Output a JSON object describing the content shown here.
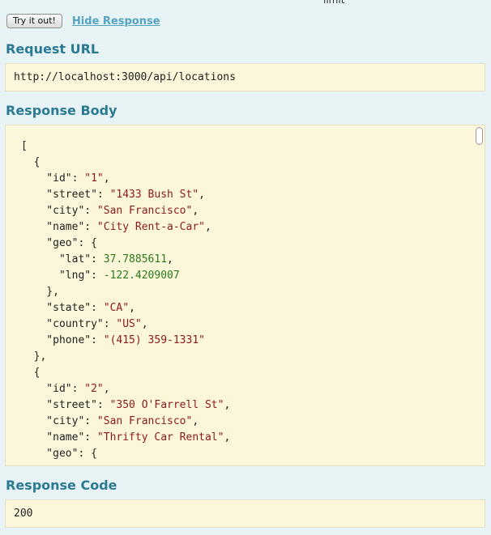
{
  "header": {
    "cut_label": "limit"
  },
  "toolbar": {
    "try_label": "Try it out!",
    "hide_label": "Hide Response"
  },
  "request": {
    "heading": "Request URL",
    "url": "http://localhost:3000/api/locations"
  },
  "response_body": {
    "heading": "Response Body",
    "lines": [
      [
        [
          "p",
          "["
        ]
      ],
      [
        [
          "p",
          "  {"
        ]
      ],
      [
        [
          "p",
          "    \"id\": "
        ],
        [
          "s",
          "\"1\""
        ],
        [
          "p",
          ","
        ]
      ],
      [
        [
          "p",
          "    \"street\": "
        ],
        [
          "s",
          "\"1433 Bush St\""
        ],
        [
          "p",
          ","
        ]
      ],
      [
        [
          "p",
          "    \"city\": "
        ],
        [
          "s",
          "\"San Francisco\""
        ],
        [
          "p",
          ","
        ]
      ],
      [
        [
          "p",
          "    \"name\": "
        ],
        [
          "s",
          "\"City Rent-a-Car\""
        ],
        [
          "p",
          ","
        ]
      ],
      [
        [
          "p",
          "    \"geo\": {"
        ]
      ],
      [
        [
          "p",
          "      \"lat\": "
        ],
        [
          "n",
          "37.7885611"
        ],
        [
          "p",
          ","
        ]
      ],
      [
        [
          "p",
          "      \"lng\": "
        ],
        [
          "n",
          "-122.4209007"
        ]
      ],
      [
        [
          "p",
          "    },"
        ]
      ],
      [
        [
          "p",
          "    \"state\": "
        ],
        [
          "s",
          "\"CA\""
        ],
        [
          "p",
          ","
        ]
      ],
      [
        [
          "p",
          "    \"country\": "
        ],
        [
          "s",
          "\"US\""
        ],
        [
          "p",
          ","
        ]
      ],
      [
        [
          "p",
          "    \"phone\": "
        ],
        [
          "s",
          "\"(415) 359-1331\""
        ]
      ],
      [
        [
          "p",
          "  },"
        ]
      ],
      [
        [
          "p",
          "  {"
        ]
      ],
      [
        [
          "p",
          "    \"id\": "
        ],
        [
          "s",
          "\"2\""
        ],
        [
          "p",
          ","
        ]
      ],
      [
        [
          "p",
          "    \"street\": "
        ],
        [
          "s",
          "\"350 O'Farrell St\""
        ],
        [
          "p",
          ","
        ]
      ],
      [
        [
          "p",
          "    \"city\": "
        ],
        [
          "s",
          "\"San Francisco\""
        ],
        [
          "p",
          ","
        ]
      ],
      [
        [
          "p",
          "    \"name\": "
        ],
        [
          "s",
          "\"Thrifty Car Rental\""
        ],
        [
          "p",
          ","
        ]
      ],
      [
        [
          "p",
          "    \"geo\": {"
        ]
      ]
    ]
  },
  "response_code": {
    "heading": "Response Code",
    "value": "200"
  }
}
